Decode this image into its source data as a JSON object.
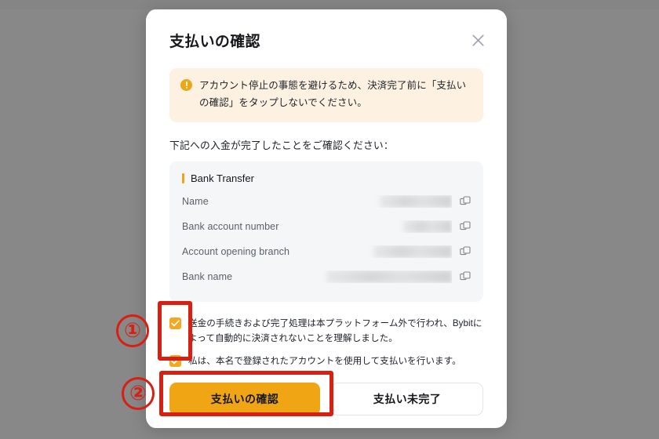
{
  "modal": {
    "title": "支払いの確認",
    "close_icon": "close-icon",
    "alert": {
      "icon": "warning-circle-icon",
      "text": "アカウント停止の事態を避けるため、決済完了前に「支払いの確認」をタップしないでください。"
    },
    "instruction": "下記への入金が完了したことをご確認ください：",
    "bank_card": {
      "title": "Bank Transfer",
      "rows": [
        {
          "label": "Name",
          "value": "",
          "masked": true,
          "copy_icon": "copy-icon",
          "mask_width": 92
        },
        {
          "label": "Bank account number",
          "value": "",
          "masked": true,
          "copy_icon": "copy-icon",
          "mask_width": 62
        },
        {
          "label": "Account opening branch",
          "value": "",
          "masked": true,
          "copy_icon": "copy-icon",
          "mask_width": 100
        },
        {
          "label": "Bank name",
          "value": "",
          "masked": true,
          "copy_icon": "copy-icon",
          "mask_width": 160
        }
      ]
    },
    "checkboxes": [
      {
        "checked": true,
        "label": "送金の手続きおよび完了処理は本プラットフォーム外で行われ、Bybitによって自動的に決済されないことを理解しました。"
      },
      {
        "checked": true,
        "label": "私は、本名で登録されたアカウントを使用して支払いを行います。"
      }
    ],
    "buttons": {
      "primary": "支払いの確認",
      "secondary": "支払い未完了"
    }
  },
  "annotations": {
    "marker_1": "①",
    "marker_2": "②",
    "color": "#d91f12"
  },
  "colors": {
    "accent_orange": "#f0a515",
    "alert_bg": "#fdf2e2",
    "card_bg": "#f5f6f7",
    "backdrop": "#888889",
    "annotation_red": "#d91f12"
  }
}
